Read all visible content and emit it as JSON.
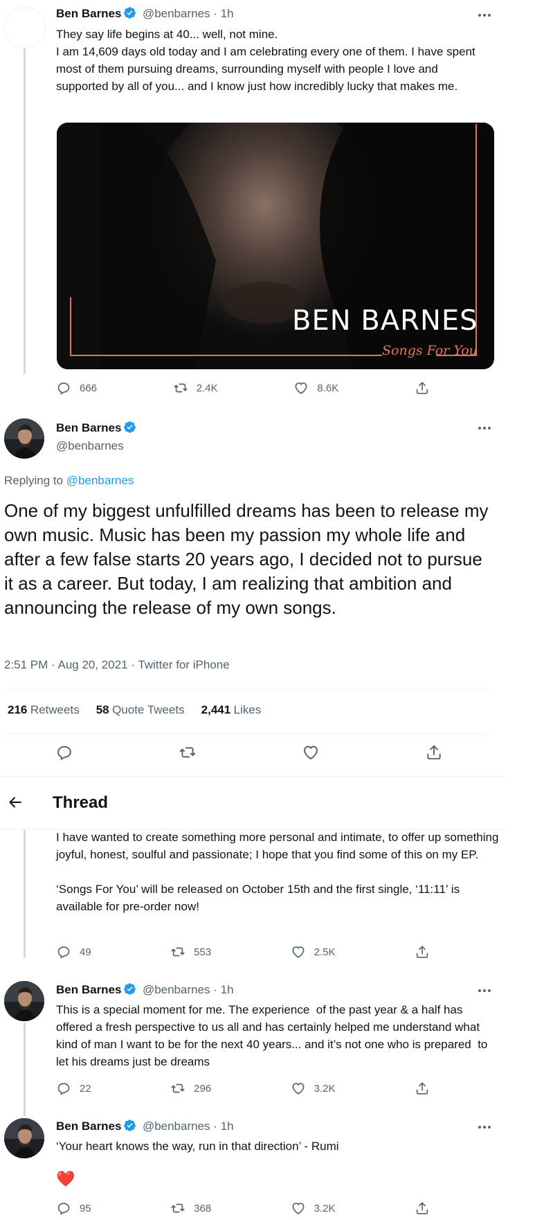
{
  "colors": {
    "accent": "#1d9bf0",
    "verified": "#1d9bf0",
    "text": "#0f1419",
    "muted": "#536471",
    "heart": "#f91880",
    "media_border": "#e2735c"
  },
  "tweet1": {
    "name": "Ben Barnes",
    "handle": "@benbarnes · 1h",
    "line1": "They say life begins at 40... well, not mine.",
    "body": "I am 14,609 days old today and I am celebrating every one of them. I have spent most of them pursuing dreams, surrounding myself with people I love and supported by all of you... and I know just how incredibly lucky that makes me.",
    "media_title": "BEN BARNES",
    "media_subtitle": "Songs For You",
    "replies": "666",
    "retweets": "2.4K",
    "likes": "8.6K"
  },
  "main_tweet": {
    "name": "Ben Barnes",
    "handle": "@benbarnes",
    "replying_prefix": "Replying to",
    "replying_handle": "@benbarnes",
    "text": "One of my biggest unfulfilled dreams has been to release my own music. Music has been my passion my whole life and after a few false starts 20 years ago, I decided not to pursue it as a career. But today, I am realizing that ambition and announcing the release of my own songs.",
    "meta": "2:51 PM · Aug 20, 2021 · Twitter for iPhone",
    "retweets_num": "216",
    "retweets_label": "Retweets",
    "quotes_num": "58",
    "quotes_label": "Quote Tweets",
    "likes_num": "2,441",
    "likes_label": "Likes"
  },
  "thread_header": {
    "back_icon": "arrow-left-icon",
    "title": "Thread"
  },
  "tweet3": {
    "para1": "I have wanted to create something more personal and intimate, to offer up something joyful, honest, soulful and passionate; I hope that you find some of this on my EP.",
    "para2": "‘Songs For You’ will be released on October 15th and the first single, ‘11:11’ is available for pre-order now!",
    "replies": "49",
    "retweets": "553",
    "likes": "2.5K"
  },
  "tweet4": {
    "name": "Ben Barnes",
    "handle": "@benbarnes · 1h",
    "body": "This is a special moment for me. The experience  of the past year & a half has offered a fresh perspective to us all and has certainly helped me understand what kind of man I want to be for the next 40 years... and it’s not one who is prepared  to let his dreams just be dreams",
    "replies": "22",
    "retweets": "296",
    "likes": "3.2K"
  },
  "tweet5": {
    "name": "Ben Barnes",
    "handle": "@benbarnes · 1h",
    "body": "‘Your heart knows the way, run in that direction’ - Rumi",
    "emoji": "❤️",
    "replies": "95",
    "retweets": "368",
    "likes": "3.2K"
  }
}
